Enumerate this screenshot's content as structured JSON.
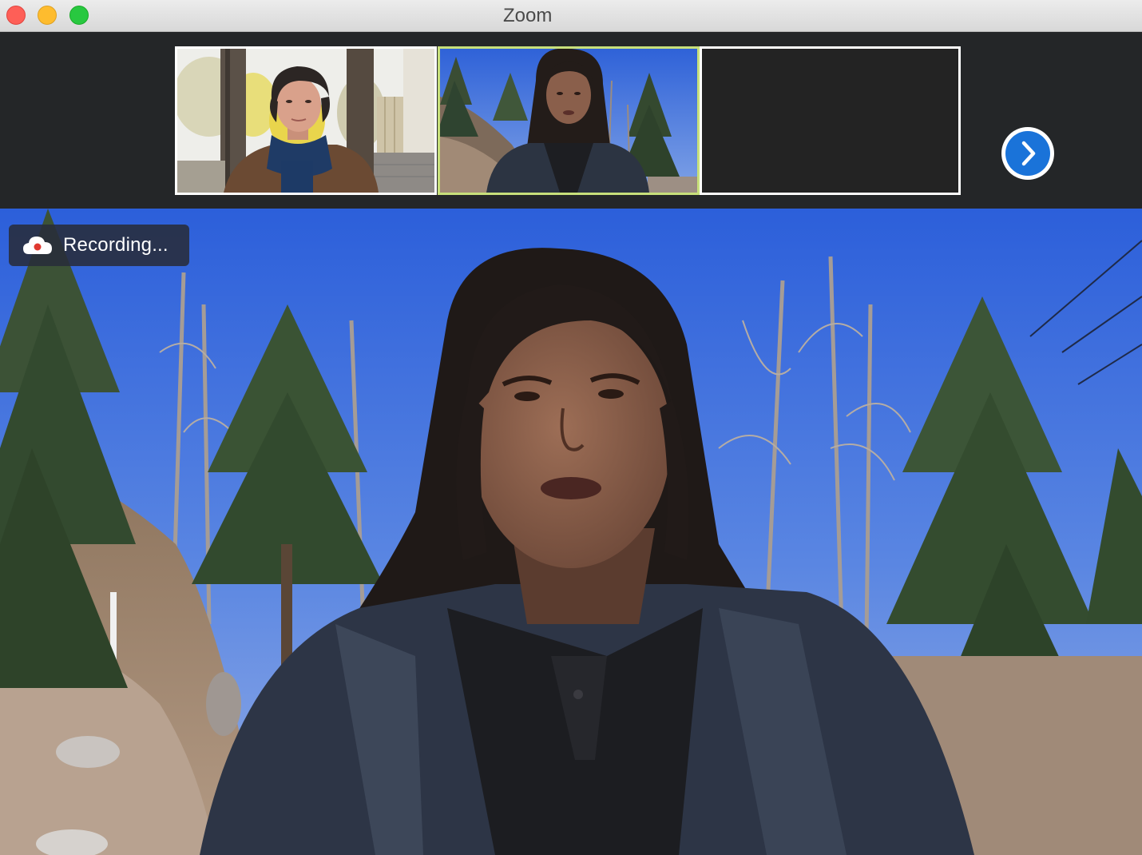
{
  "window": {
    "title": "Zoom",
    "controls": [
      "close",
      "minimize",
      "maximize"
    ]
  },
  "gallery_strip": {
    "participants": [
      {
        "tile": "participant-1",
        "active_speaker": false,
        "video": "woman with short dark hair and blue scarf on porch"
      },
      {
        "tile": "participant-2",
        "active_speaker": true,
        "video": "man with long dark hair outdoors among trees"
      },
      {
        "tile": "participant-3",
        "active_speaker": false,
        "video": "camera off"
      }
    ],
    "next_page_icon": "chevron-right-icon"
  },
  "recording": {
    "label": "Recording...",
    "icon": "cloud-record-icon"
  },
  "colors": {
    "active_speaker_border": "#c8e07b",
    "tile_border": "#ffffff",
    "next_button": "#1a73d9",
    "strip_background": "#242628"
  }
}
